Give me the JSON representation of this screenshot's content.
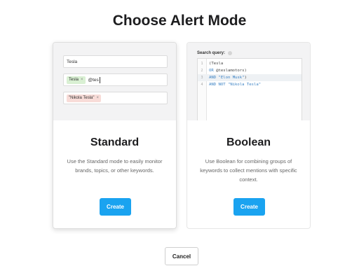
{
  "page": {
    "title": "Choose Alert Mode"
  },
  "standard": {
    "preview": {
      "input1_value": "Tesla",
      "tag1": "Tesla",
      "tag1_remove": "×",
      "typed_text": "@tes",
      "tag2": "\"Nikola Tesla\"",
      "tag2_remove": "×"
    },
    "title": "Standard",
    "description": "Use the Standard mode to easily monitor brands, topics, or other keywords.",
    "create_label": "Create"
  },
  "boolean": {
    "preview": {
      "query_label": "Search query:",
      "lines": [
        {
          "num": "1",
          "parts": [
            [
              "plain",
              "(Tesla"
            ]
          ]
        },
        {
          "num": "2",
          "parts": [
            [
              "kw",
              "OR "
            ],
            [
              "plain",
              "@teslamotors)"
            ]
          ]
        },
        {
          "num": "3",
          "parts": [
            [
              "kw",
              "AND "
            ],
            [
              "str",
              "\"Elon Musk\""
            ],
            [
              "plain",
              ")"
            ]
          ]
        },
        {
          "num": "4",
          "parts": [
            [
              "kw",
              "AND NOT "
            ],
            [
              "str",
              "\"Nikola Tesla\""
            ]
          ]
        }
      ]
    },
    "title": "Boolean",
    "description": "Use Boolean for combining groups of keywords to collect mentions with specific context.",
    "create_label": "Create"
  },
  "footer": {
    "cancel_label": "Cancel"
  },
  "colors": {
    "primary": "#1aa3f0",
    "tag_green": "#d9f0d3",
    "tag_red": "#f8dcd8"
  }
}
